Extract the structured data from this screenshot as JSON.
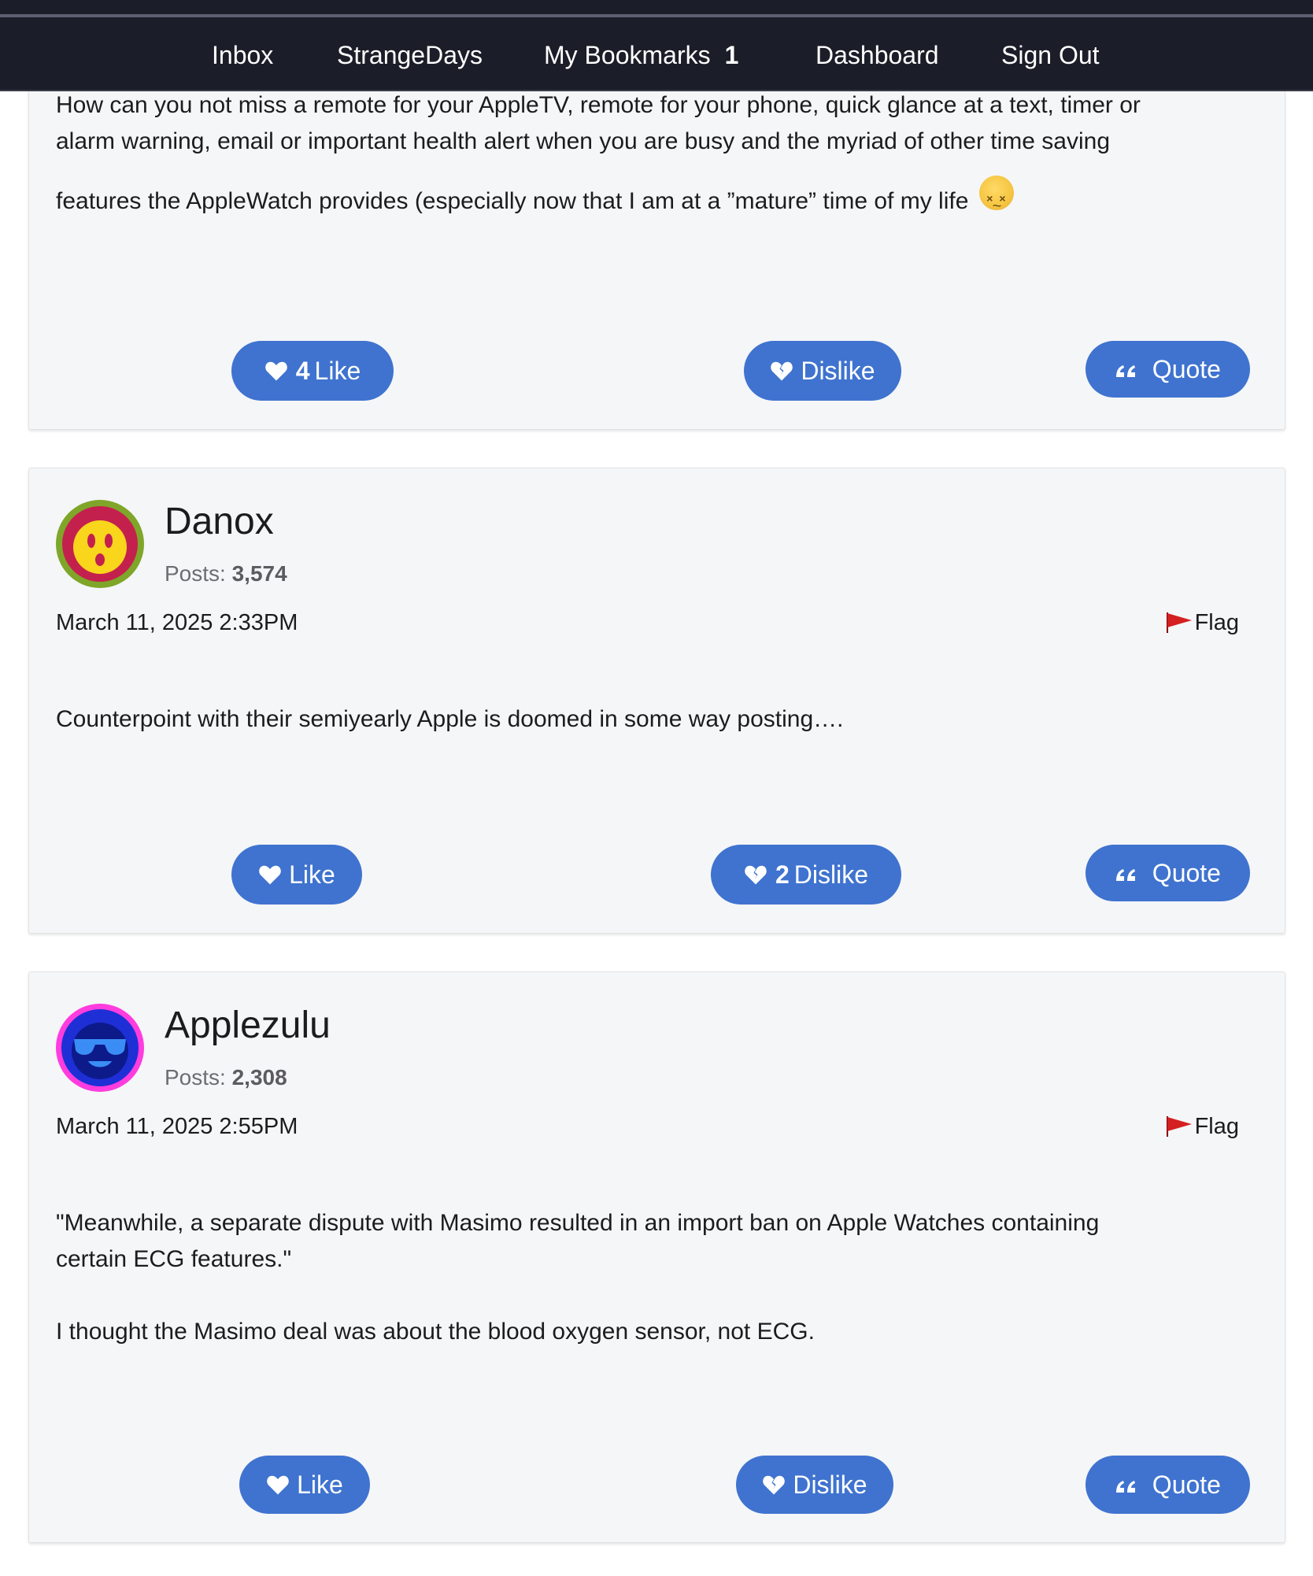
{
  "nav": {
    "inbox": "Inbox",
    "user": "StrangeDays",
    "bookmarks": "My Bookmarks",
    "bookmarks_count": "1",
    "dashboard": "Dashboard",
    "signout": "Sign Out"
  },
  "posts": [
    {
      "text_line1": "How can you not miss a remote for your AppleTV, remote for your phone, quick glance at a text, timer or",
      "text_line2": "alarm warning, email or important health alert when you are busy and the myriad of other time saving",
      "text_line3": "features the AppleWatch provides (especially now that I am at a ”mature” time of my life",
      "like_count": "4",
      "like_label": "Like",
      "dislike_label": "Dislike",
      "quote_label": "Quote"
    },
    {
      "author": "Danox",
      "posts_label": "Posts:",
      "posts_count": "3,574",
      "date": "March 11, 2025 2:33PM",
      "flag_label": "Flag",
      "text": "Counterpoint with their semiyearly Apple is doomed in some way posting….",
      "like_label": "Like",
      "dislike_count": "2",
      "dislike_label": "Dislike",
      "quote_label": "Quote"
    },
    {
      "author": "Applezulu",
      "posts_label": "Posts:",
      "posts_count": "2,308",
      "date": "March 11, 2025 2:55PM",
      "flag_label": "Flag",
      "text_line1": "\"Meanwhile, a separate dispute with Masimo resulted in an import ban on Apple Watches containing",
      "text_line2": "certain ECG features.\"",
      "text_line3": "I thought the Masimo deal was about the blood oxygen sensor, not ECG.",
      "like_label": "Like",
      "dislike_label": "Dislike",
      "quote_label": "Quote"
    }
  ],
  "colors": {
    "nav_bg": "#1b1d28",
    "button_blue": "#3f73cf",
    "flag_red": "#d42020",
    "card_bg": "#f5f6f8"
  },
  "icons": {
    "like": "heart-icon",
    "dislike": "broken-heart-icon",
    "quote": "quote-icon",
    "flag": "flag-icon"
  }
}
